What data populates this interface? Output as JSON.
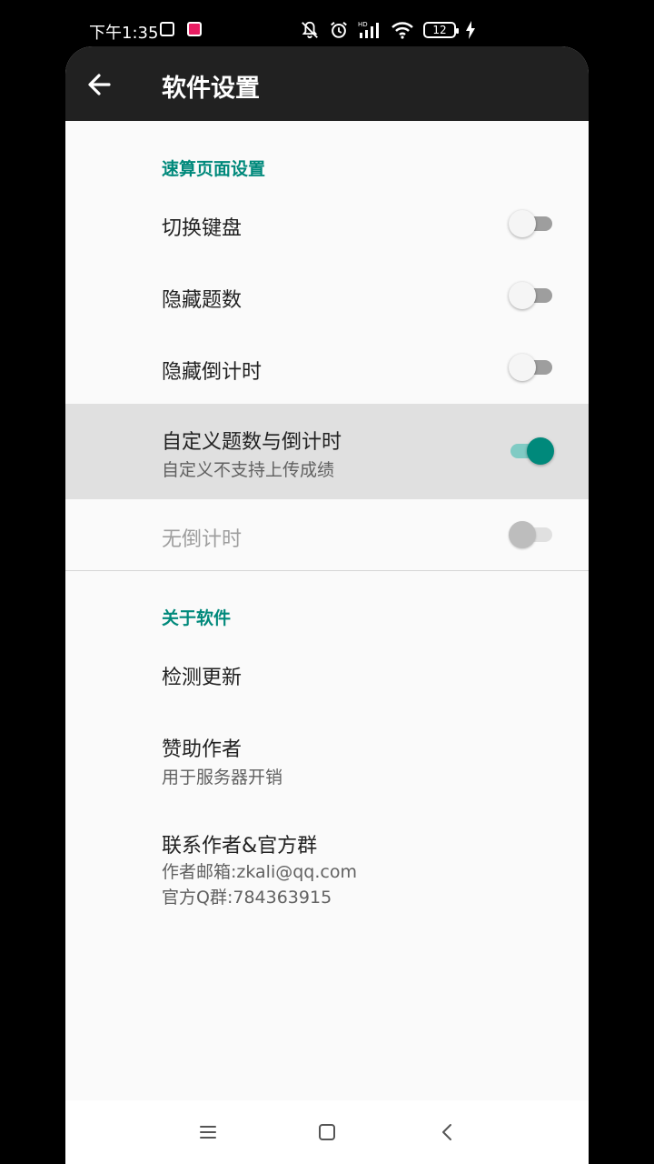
{
  "status_bar": {
    "time": "下午1:35",
    "battery": "12"
  },
  "toolbar": {
    "title": "软件设置"
  },
  "sections": [
    {
      "header": "速算页面设置",
      "items": [
        {
          "title": "切换键盘",
          "switch": "off"
        },
        {
          "title": "隐藏题数",
          "switch": "off"
        },
        {
          "title": "隐藏倒计时",
          "switch": "off"
        },
        {
          "title": "自定义题数与倒计时",
          "subtitle": "自定义不支持上传成绩",
          "switch": "on"
        },
        {
          "title": "无倒计时",
          "switch": "disabled"
        }
      ]
    },
    {
      "header": "关于软件",
      "items": [
        {
          "title": "检测更新"
        },
        {
          "title": "赞助作者",
          "subtitle": "用于服务器开销"
        },
        {
          "title": "联系作者&官方群",
          "subtitle": "作者邮箱:zkali@qq.com",
          "subtitle2": "官方Q群:784363915"
        }
      ]
    }
  ],
  "colors": {
    "accent": "#00897b",
    "toolbar": "#212121",
    "highlight": "#e0e0e0"
  },
  "icons": {
    "back": "arrow-left-icon",
    "nav_menu": "menu-icon",
    "nav_home": "home-square-icon",
    "nav_back": "chevron-left-icon"
  }
}
